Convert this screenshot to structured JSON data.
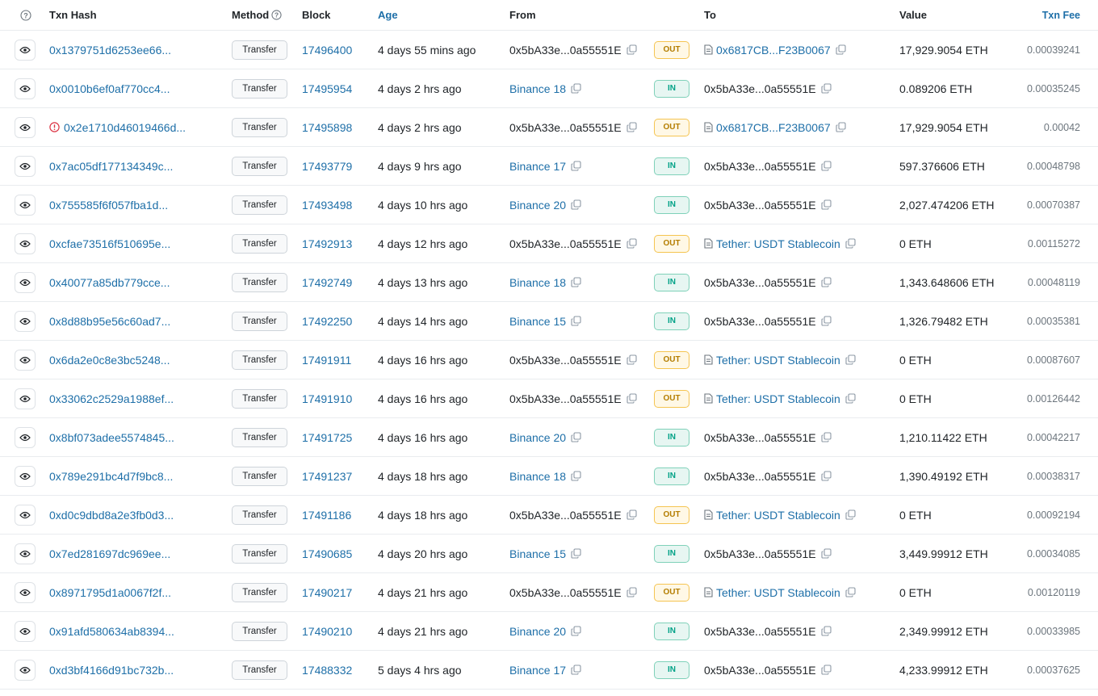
{
  "header": {
    "hash": "Txn Hash",
    "method": "Method",
    "block": "Block",
    "age": "Age",
    "from": "From",
    "to": "To",
    "value": "Value",
    "fee": "Txn Fee"
  },
  "colors": {
    "link": "#1e6fa8",
    "out": "#b47d00",
    "in": "#00a186",
    "error": "#dc3545"
  },
  "rows": [
    {
      "hash": "0x1379751d6253ee66...",
      "method": "Transfer",
      "block": "17496400",
      "age": "4 days 55 mins ago",
      "from": "0x5bA33e...0a55551E",
      "from_link": false,
      "dir": "OUT",
      "to": "0x6817CB...F23B0067",
      "to_link": true,
      "value": "17,929.9054 ETH",
      "fee": "0.00039241",
      "error": false
    },
    {
      "hash": "0x0010b6ef0af770cc4...",
      "method": "Transfer",
      "block": "17495954",
      "age": "4 days 2 hrs ago",
      "from": "Binance 18",
      "from_link": true,
      "dir": "IN",
      "to": "0x5bA33e...0a55551E",
      "to_link": false,
      "value": "0.089206 ETH",
      "fee": "0.00035245",
      "error": false
    },
    {
      "hash": "0x2e1710d46019466d...",
      "method": "Transfer",
      "block": "17495898",
      "age": "4 days 2 hrs ago",
      "from": "0x5bA33e...0a55551E",
      "from_link": false,
      "dir": "OUT",
      "to": "0x6817CB...F23B0067",
      "to_link": true,
      "value": "17,929.9054 ETH",
      "fee": "0.00042",
      "error": true
    },
    {
      "hash": "0x7ac05df177134349c...",
      "method": "Transfer",
      "block": "17493779",
      "age": "4 days 9 hrs ago",
      "from": "Binance 17",
      "from_link": true,
      "dir": "IN",
      "to": "0x5bA33e...0a55551E",
      "to_link": false,
      "value": "597.376606 ETH",
      "fee": "0.00048798",
      "error": false
    },
    {
      "hash": "0x755585f6f057fba1d...",
      "method": "Transfer",
      "block": "17493498",
      "age": "4 days 10 hrs ago",
      "from": "Binance 20",
      "from_link": true,
      "dir": "IN",
      "to": "0x5bA33e...0a55551E",
      "to_link": false,
      "value": "2,027.474206 ETH",
      "fee": "0.00070387",
      "error": false
    },
    {
      "hash": "0xcfae73516f510695e...",
      "method": "Transfer",
      "block": "17492913",
      "age": "4 days 12 hrs ago",
      "from": "0x5bA33e...0a55551E",
      "from_link": false,
      "dir": "OUT",
      "to": "Tether: USDT Stablecoin",
      "to_link": true,
      "value": "0 ETH",
      "fee": "0.00115272",
      "error": false
    },
    {
      "hash": "0x40077a85db779cce...",
      "method": "Transfer",
      "block": "17492749",
      "age": "4 days 13 hrs ago",
      "from": "Binance 18",
      "from_link": true,
      "dir": "IN",
      "to": "0x5bA33e...0a55551E",
      "to_link": false,
      "value": "1,343.648606 ETH",
      "fee": "0.00048119",
      "error": false
    },
    {
      "hash": "0x8d88b95e56c60ad7...",
      "method": "Transfer",
      "block": "17492250",
      "age": "4 days 14 hrs ago",
      "from": "Binance 15",
      "from_link": true,
      "dir": "IN",
      "to": "0x5bA33e...0a55551E",
      "to_link": false,
      "value": "1,326.79482 ETH",
      "fee": "0.00035381",
      "error": false
    },
    {
      "hash": "0x6da2e0c8e3bc5248...",
      "method": "Transfer",
      "block": "17491911",
      "age": "4 days 16 hrs ago",
      "from": "0x5bA33e...0a55551E",
      "from_link": false,
      "dir": "OUT",
      "to": "Tether: USDT Stablecoin",
      "to_link": true,
      "value": "0 ETH",
      "fee": "0.00087607",
      "error": false
    },
    {
      "hash": "0x33062c2529a1988ef...",
      "method": "Transfer",
      "block": "17491910",
      "age": "4 days 16 hrs ago",
      "from": "0x5bA33e...0a55551E",
      "from_link": false,
      "dir": "OUT",
      "to": "Tether: USDT Stablecoin",
      "to_link": true,
      "value": "0 ETH",
      "fee": "0.00126442",
      "error": false
    },
    {
      "hash": "0x8bf073adee5574845...",
      "method": "Transfer",
      "block": "17491725",
      "age": "4 days 16 hrs ago",
      "from": "Binance 20",
      "from_link": true,
      "dir": "IN",
      "to": "0x5bA33e...0a55551E",
      "to_link": false,
      "value": "1,210.11422 ETH",
      "fee": "0.00042217",
      "error": false
    },
    {
      "hash": "0x789e291bc4d7f9bc8...",
      "method": "Transfer",
      "block": "17491237",
      "age": "4 days 18 hrs ago",
      "from": "Binance 18",
      "from_link": true,
      "dir": "IN",
      "to": "0x5bA33e...0a55551E",
      "to_link": false,
      "value": "1,390.49192 ETH",
      "fee": "0.00038317",
      "error": false
    },
    {
      "hash": "0xd0c9dbd8a2e3fb0d3...",
      "method": "Transfer",
      "block": "17491186",
      "age": "4 days 18 hrs ago",
      "from": "0x5bA33e...0a55551E",
      "from_link": false,
      "dir": "OUT",
      "to": "Tether: USDT Stablecoin",
      "to_link": true,
      "value": "0 ETH",
      "fee": "0.00092194",
      "error": false
    },
    {
      "hash": "0x7ed281697dc969ee...",
      "method": "Transfer",
      "block": "17490685",
      "age": "4 days 20 hrs ago",
      "from": "Binance 15",
      "from_link": true,
      "dir": "IN",
      "to": "0x5bA33e...0a55551E",
      "to_link": false,
      "value": "3,449.99912 ETH",
      "fee": "0.00034085",
      "error": false
    },
    {
      "hash": "0x8971795d1a0067f2f...",
      "method": "Transfer",
      "block": "17490217",
      "age": "4 days 21 hrs ago",
      "from": "0x5bA33e...0a55551E",
      "from_link": false,
      "dir": "OUT",
      "to": "Tether: USDT Stablecoin",
      "to_link": true,
      "value": "0 ETH",
      "fee": "0.00120119",
      "error": false
    },
    {
      "hash": "0x91afd580634ab8394...",
      "method": "Transfer",
      "block": "17490210",
      "age": "4 days 21 hrs ago",
      "from": "Binance 20",
      "from_link": true,
      "dir": "IN",
      "to": "0x5bA33e...0a55551E",
      "to_link": false,
      "value": "2,349.99912 ETH",
      "fee": "0.00033985",
      "error": false
    },
    {
      "hash": "0xd3bf4166d91bc732b...",
      "method": "Transfer",
      "block": "17488332",
      "age": "5 days 4 hrs ago",
      "from": "Binance 17",
      "from_link": true,
      "dir": "IN",
      "to": "0x5bA33e...0a55551E",
      "to_link": false,
      "value": "4,233.99912 ETH",
      "fee": "0.00037625",
      "error": false
    }
  ]
}
